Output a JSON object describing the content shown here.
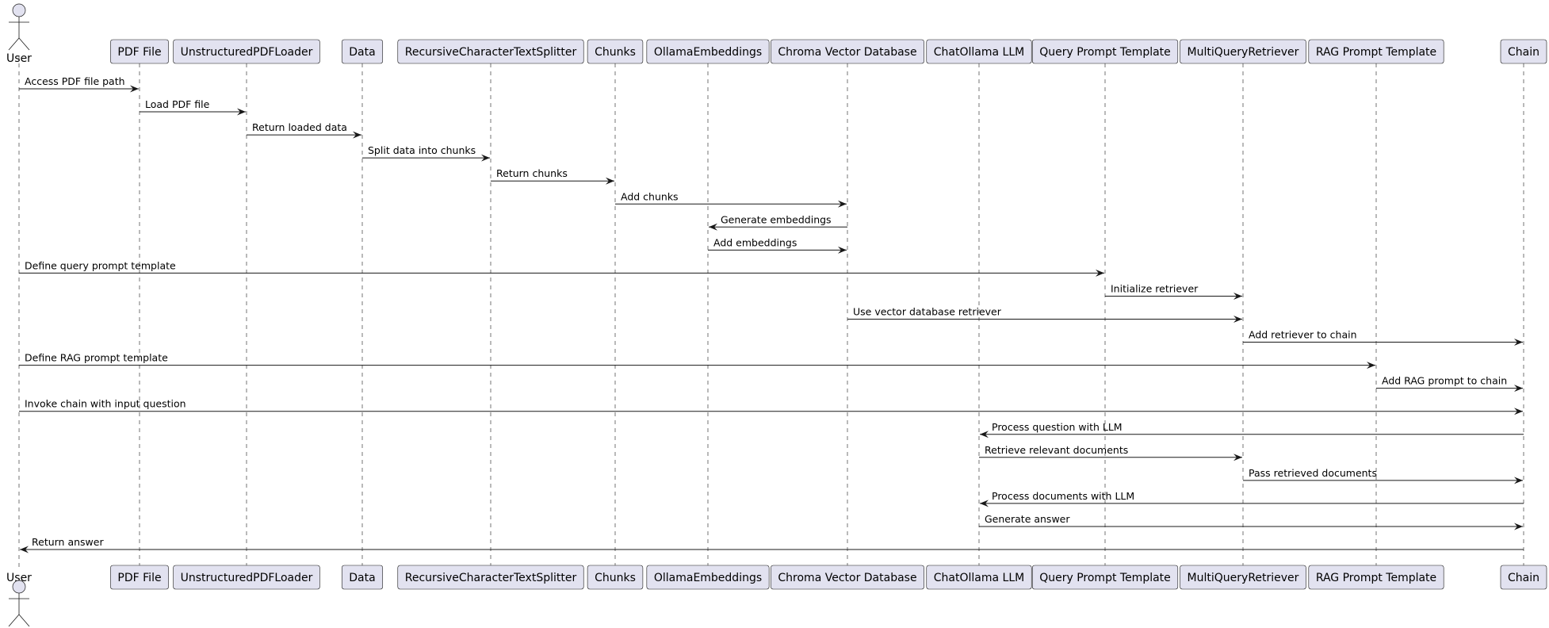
{
  "diagram_type": "sequence",
  "colors": {
    "participant_fill": "#E2E2F0",
    "line": "#181818"
  },
  "participants": [
    {
      "name": "User",
      "kind": "actor"
    },
    {
      "name": "PDF File",
      "kind": "participant"
    },
    {
      "name": "UnstructuredPDFLoader",
      "kind": "participant"
    },
    {
      "name": "Data",
      "kind": "participant"
    },
    {
      "name": "RecursiveCharacterTextSplitter",
      "kind": "participant"
    },
    {
      "name": "Chunks",
      "kind": "participant"
    },
    {
      "name": "OllamaEmbeddings",
      "kind": "participant"
    },
    {
      "name": "Chroma Vector Database",
      "kind": "participant"
    },
    {
      "name": "ChatOllama LLM",
      "kind": "participant"
    },
    {
      "name": "Query Prompt Template",
      "kind": "participant"
    },
    {
      "name": "MultiQueryRetriever",
      "kind": "participant"
    },
    {
      "name": "RAG Prompt Template",
      "kind": "participant"
    },
    {
      "name": "Chain",
      "kind": "participant"
    }
  ],
  "messages": [
    {
      "from": 0,
      "to": 1,
      "label": "Access PDF file path"
    },
    {
      "from": 1,
      "to": 2,
      "label": "Load PDF file"
    },
    {
      "from": 2,
      "to": 3,
      "label": "Return loaded data"
    },
    {
      "from": 3,
      "to": 4,
      "label": "Split data into chunks"
    },
    {
      "from": 4,
      "to": 5,
      "label": "Return chunks"
    },
    {
      "from": 5,
      "to": 7,
      "label": "Add chunks"
    },
    {
      "from": 7,
      "to": 6,
      "label": "Generate embeddings"
    },
    {
      "from": 6,
      "to": 7,
      "label": "Add embeddings"
    },
    {
      "from": 0,
      "to": 9,
      "label": "Define query prompt template"
    },
    {
      "from": 9,
      "to": 10,
      "label": "Initialize retriever"
    },
    {
      "from": 7,
      "to": 10,
      "label": "Use vector database retriever"
    },
    {
      "from": 10,
      "to": 12,
      "label": "Add retriever to chain"
    },
    {
      "from": 0,
      "to": 11,
      "label": "Define RAG prompt template"
    },
    {
      "from": 11,
      "to": 12,
      "label": "Add RAG prompt to chain"
    },
    {
      "from": 0,
      "to": 12,
      "label": "Invoke chain with input question"
    },
    {
      "from": 12,
      "to": 8,
      "label": "Process question with LLM"
    },
    {
      "from": 8,
      "to": 10,
      "label": "Retrieve relevant documents"
    },
    {
      "from": 10,
      "to": 12,
      "label": "Pass retrieved documents"
    },
    {
      "from": 12,
      "to": 8,
      "label": "Process documents with LLM"
    },
    {
      "from": 8,
      "to": 12,
      "label": "Generate answer"
    },
    {
      "from": 12,
      "to": 0,
      "label": "Return answer"
    }
  ]
}
